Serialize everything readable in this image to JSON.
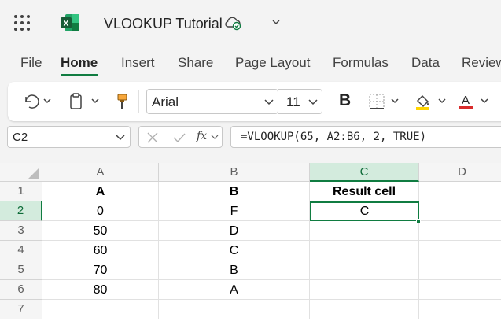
{
  "title_bar": {
    "doc_title": "VLOOKUP Tutorial",
    "app_logo_letter": "X"
  },
  "ribbon": {
    "tabs": [
      {
        "label": "File"
      },
      {
        "label": "Home"
      },
      {
        "label": "Insert"
      },
      {
        "label": "Share"
      },
      {
        "label": "Page Layout"
      },
      {
        "label": "Formulas"
      },
      {
        "label": "Data"
      },
      {
        "label": "Review"
      }
    ],
    "active_tab": "Home"
  },
  "toolbar": {
    "font_name": "Arial",
    "font_size": "11",
    "bold_label": "B",
    "font_color_letter": "A",
    "highlight_color": "#ffd400",
    "font_color": "#d92c2c"
  },
  "formula_bar": {
    "name_box": "C2",
    "fx_label": "fx",
    "formula": "=VLOOKUP(65, A2:B6, 2, TRUE)"
  },
  "grid": {
    "columns": [
      "A",
      "B",
      "C",
      "D"
    ],
    "rows": [
      "1",
      "2",
      "3",
      "4",
      "5",
      "6",
      "7"
    ],
    "cells": [
      [
        "A",
        "B",
        "Result cell",
        ""
      ],
      [
        "0",
        "F",
        "C",
        ""
      ],
      [
        "50",
        "D",
        "",
        ""
      ],
      [
        "60",
        "C",
        "",
        ""
      ],
      [
        "70",
        "B",
        "",
        ""
      ],
      [
        "80",
        "A",
        "",
        ""
      ],
      [
        "",
        "",
        "",
        ""
      ]
    ],
    "active_cell": "C2",
    "accent_color": "#107c41"
  }
}
